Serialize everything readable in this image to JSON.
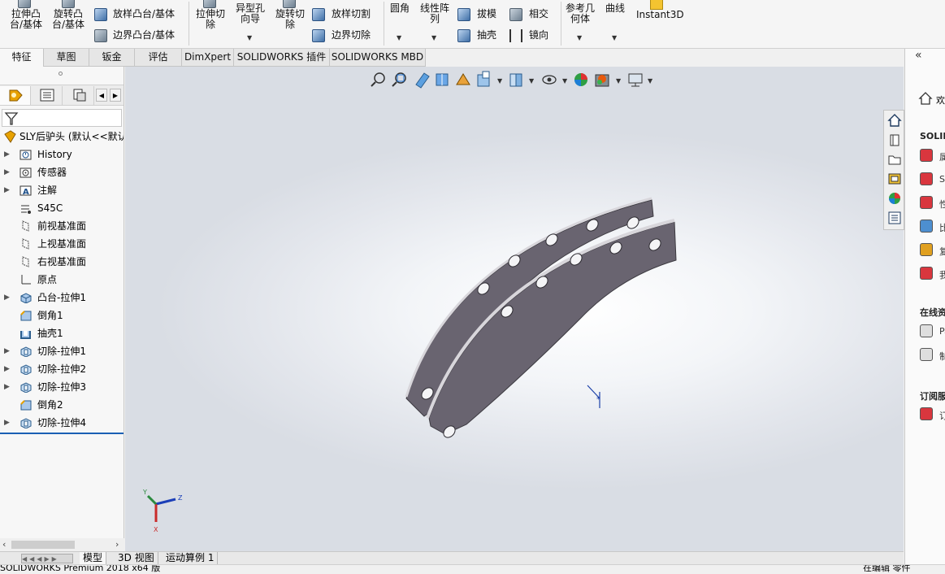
{
  "ribbon": {
    "extrude_boss": "拉伸凸台/基体",
    "revolve_boss": "旋转凸台/基体",
    "loft_boss": "放样凸台/基体",
    "boundary_boss": "边界凸台/基体",
    "extrude_cut": "拉伸切除",
    "hole_wizard": "异型孔向导",
    "revolve_cut": "旋转切除",
    "loft_cut": "放样切割",
    "boundary_cut": "边界切除",
    "fillet": "圆角",
    "linear_pattern": "线性阵列",
    "draft": "拔模",
    "shell": "抽壳",
    "intersect": "相交",
    "mirror": "镜向",
    "reference_geometry": "参考几何体",
    "curves": "曲线",
    "instant3d": "Instant3D"
  },
  "tabs": [
    "特征",
    "草图",
    "钣金",
    "评估",
    "DimXpert",
    "SOLIDWORKS 插件",
    "SOLIDWORKS MBD"
  ],
  "active_tab": "特征",
  "tree": {
    "root": "SLY后驴头 (默认<<默认",
    "items": [
      {
        "label": "History",
        "icon": "history-icon",
        "expandable": true
      },
      {
        "label": "传感器",
        "icon": "sensor-icon",
        "expandable": true
      },
      {
        "label": "注解",
        "icon": "annotation-icon",
        "expandable": true
      },
      {
        "label": "S45C",
        "icon": "material-icon",
        "expandable": false
      },
      {
        "label": "前视基准面",
        "icon": "plane-icon",
        "expandable": false
      },
      {
        "label": "上视基准面",
        "icon": "plane-icon",
        "expandable": false
      },
      {
        "label": "右视基准面",
        "icon": "plane-icon",
        "expandable": false
      },
      {
        "label": "原点",
        "icon": "origin-icon",
        "expandable": false
      },
      {
        "label": "凸台-拉伸1",
        "icon": "boss-extrude-icon",
        "expandable": true
      },
      {
        "label": "倒角1",
        "icon": "chamfer-icon",
        "expandable": false
      },
      {
        "label": "抽壳1",
        "icon": "shell-icon",
        "expandable": false
      },
      {
        "label": "切除-拉伸1",
        "icon": "cut-extrude-icon",
        "expandable": true
      },
      {
        "label": "切除-拉伸2",
        "icon": "cut-extrude-icon",
        "expandable": true
      },
      {
        "label": "切除-拉伸3",
        "icon": "cut-extrude-icon",
        "expandable": true
      },
      {
        "label": "倒角2",
        "icon": "chamfer-icon",
        "expandable": false
      },
      {
        "label": "切除-拉伸4",
        "icon": "cut-extrude-icon",
        "expandable": true
      }
    ]
  },
  "bottom_tabs": [
    "模型",
    "3D 视图",
    "运动算例 1"
  ],
  "status": {
    "left": "SOLIDWORKS Premium 2018 x64 版",
    "right": "在编辑 零件"
  },
  "triad": {
    "x": "X",
    "y": "Y",
    "z": "Z"
  },
  "right_pane": {
    "welcome": "欢",
    "section1": "SOLID",
    "section2": "在线资",
    "section3": "订阅服",
    "items1": [
      "属",
      "SO",
      "性",
      "比",
      "复",
      "我"
    ],
    "items2": [
      "Pa",
      "制"
    ],
    "items3": [
      "订"
    ]
  },
  "colors": {
    "part_face": "#696470",
    "part_edge": "#d8d6db",
    "hole": "#f4f4f6"
  }
}
